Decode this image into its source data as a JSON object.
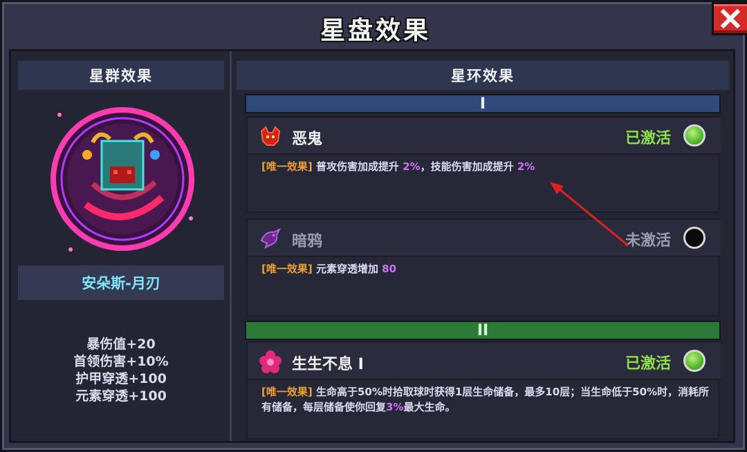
{
  "window": {
    "title": "星盘效果",
    "close_label": "X"
  },
  "left": {
    "header": "星群效果",
    "constellation_name": "安朵斯-月刃",
    "stats": [
      "暴伤值+20",
      "首领伤害+10%",
      "护甲穿透+100",
      "元素穿透+100"
    ]
  },
  "right": {
    "header": "星环效果",
    "tiers": [
      {
        "label": "I",
        "cards": [
          {
            "name": "恶鬼",
            "icon": "demon-icon",
            "status": "已激活",
            "active": true,
            "tag": "[唯一效果]",
            "desc_a": " 普攻伤害加成提升 ",
            "num_a": "2%",
            "desc_b": "，技能伤害加成提升 ",
            "num_b": "2%"
          },
          {
            "name": "暗鸦",
            "icon": "crow-icon",
            "status": "未激活",
            "active": false,
            "tag": "[唯一效果]",
            "desc_a": " 元素穿透增加 ",
            "num_a": "80"
          }
        ]
      },
      {
        "label": "II",
        "cards": [
          {
            "name": "生生不息 I",
            "icon": "flower-icon",
            "status": "已激活",
            "active": true,
            "tag": "[唯一效果]",
            "desc_a": " 生命高于50%时拾取球时获得1层生命储备，最多10层；当生命低于50%时，消耗所有储备，每层储备使你回复",
            "num_a": "3%",
            "desc_b": "最大生命。"
          }
        ]
      }
    ]
  },
  "colors": {
    "active": "#8fe04a",
    "inactive": "#9a9cb0",
    "tag": "#f0a030",
    "number": "#d070ff",
    "accent_cyan": "#7fe6ff"
  }
}
